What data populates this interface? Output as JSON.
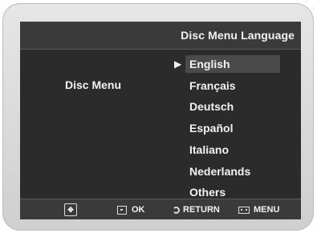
{
  "header": {
    "title": "Disc Menu Language"
  },
  "section": {
    "label": "Disc Menu"
  },
  "languages": [
    {
      "label": "English",
      "selected": true
    },
    {
      "label": "Français",
      "selected": false
    },
    {
      "label": "Deutsch",
      "selected": false
    },
    {
      "label": "Español",
      "selected": false
    },
    {
      "label": "Italiano",
      "selected": false
    },
    {
      "label": "Nederlands",
      "selected": false
    },
    {
      "label": "Others",
      "selected": false
    }
  ],
  "footer": {
    "ok_label": "OK",
    "return_label": "RETURN",
    "menu_label": "MENU"
  },
  "icons": {
    "selection_cursor": "triangle-right-icon",
    "navigation": "dpad-icon",
    "ok": "ok-icon",
    "return": "return-icon",
    "menu": "menu-icon"
  }
}
